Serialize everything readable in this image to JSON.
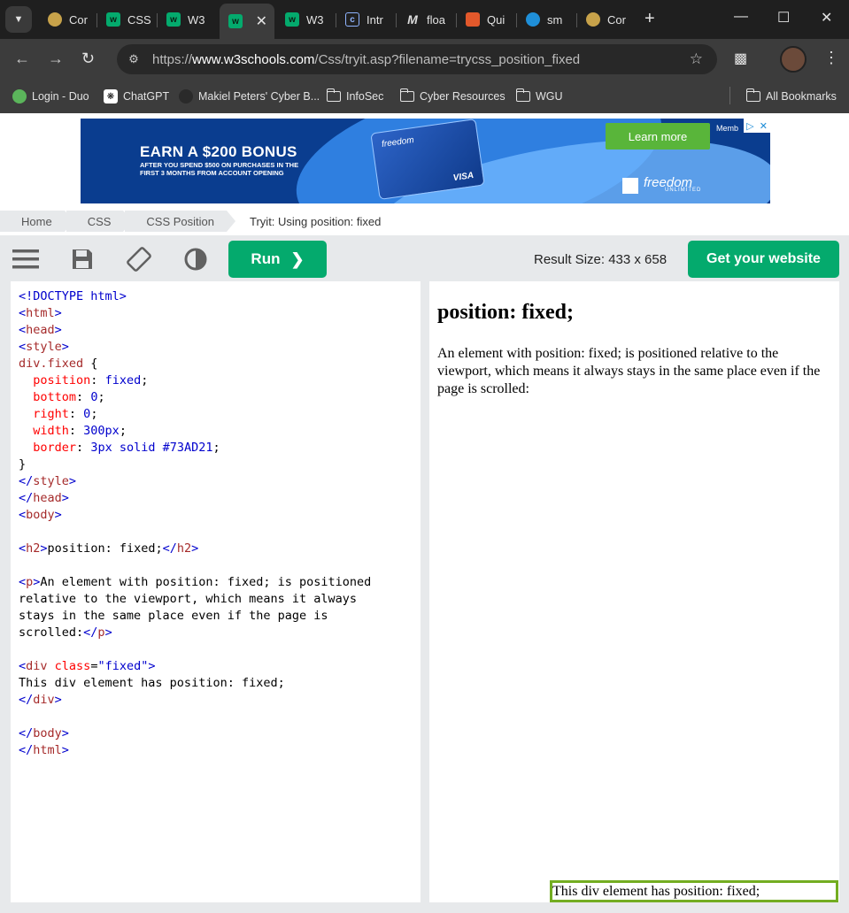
{
  "browser": {
    "tabs": [
      {
        "label": "Cor",
        "icon": "coin-icon"
      },
      {
        "label": "CSS",
        "icon": "w3schools-icon"
      },
      {
        "label": "W3",
        "icon": "w3schools-icon"
      },
      {
        "label": "",
        "icon": "w3schools-icon",
        "active": true
      },
      {
        "label": "W3",
        "icon": "w3schools-icon"
      },
      {
        "label": "Intr",
        "icon": "doc-icon"
      },
      {
        "label": "floa",
        "icon": "m-icon"
      },
      {
        "label": "Qui",
        "icon": "fox-icon"
      },
      {
        "label": "sm",
        "icon": "cloud-icon"
      },
      {
        "label": "Cor",
        "icon": "coin-icon"
      }
    ],
    "url_prefix": "https://",
    "url_domain": "www.w3schools.com",
    "url_path": "/Css/tryit.asp?filename=trycss_position_fixed",
    "bookmarks": [
      {
        "label": "Login - Duo",
        "icon": "duo-icon"
      },
      {
        "label": "ChatGPT",
        "icon": "chatgpt-icon"
      },
      {
        "label": "Makiel Peters' Cyber B...",
        "icon": "site-icon"
      },
      {
        "label": "InfoSec",
        "icon": "folder-icon"
      },
      {
        "label": "Cyber Resources",
        "icon": "folder-icon"
      },
      {
        "label": "WGU",
        "icon": "folder-icon"
      },
      {
        "label": "All Bookmarks",
        "icon": "folder-icon"
      }
    ]
  },
  "ad": {
    "headline": "EARN A $200 BONUS",
    "subtext": "AFTER YOU SPEND $500 ON PURCHASES IN THE FIRST 3 MONTHS FROM ACCOUNT OPENING",
    "card_brand": "freedom",
    "card_network": "VISA",
    "cta": "Learn more",
    "member": "Memb",
    "logo": "freedom",
    "logo_sub": "UNLIMITED"
  },
  "breadcrumb": [
    "Home",
    "CSS",
    "CSS Position",
    "Tryit: Using position: fixed"
  ],
  "toolbar": {
    "run_label": "Run",
    "result_size": "Result Size: 433 x 658",
    "get_website_label": "Get your website"
  },
  "result": {
    "heading": "position: fixed;",
    "paragraph": "An element with position: fixed; is positioned relative to the viewport, which means it always stays in the same place even if the page is scrolled:",
    "fixed_div_text": "This div element has position: fixed;"
  },
  "colors": {
    "accent": "#04aa6d",
    "fixed_border": "#73AD21"
  }
}
